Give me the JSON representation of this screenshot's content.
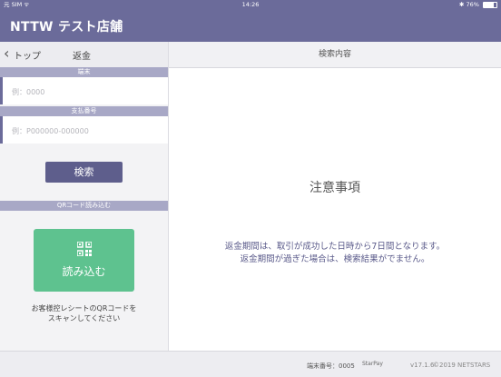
{
  "status_bar": {
    "carrier": "元 SIM ᯤ",
    "time": "14:26",
    "battery_text": "76%",
    "battery_level": 0.76
  },
  "nav": {
    "app_title": "NTTW テスト店舗"
  },
  "left_panel": {
    "back_label": "トップ",
    "panel_title": "返金",
    "terminal_section": "端末",
    "terminal_placeholder": "例：0000",
    "payment_section": "支払番号",
    "payment_placeholder": "例：P000000-000000",
    "search_button": "検索",
    "qr_section": "QRコード読み込む",
    "qr_button": "読み込む",
    "qr_note_line1": "お客様控レシートのQRコードを",
    "qr_note_line2": "スキャンしてください"
  },
  "right_panel": {
    "header": "検索内容",
    "notice_title": "注意事項",
    "notice_line1": "返金期間は、取引が成功した日時から7日間となります。",
    "notice_line2": "返金期間が過ぎた場合は、検索結果がでません。"
  },
  "footer": {
    "terminal_label": "端末番号：",
    "terminal_number": "0005",
    "logo_text": "StarPay",
    "version": "v17.1.6",
    "copyright": "©2019 NETSTARS"
  },
  "colors": {
    "nav_bg": "#6b6b9a",
    "section_header": "#a8a8c6",
    "search_button": "#5e5e8c",
    "qr_button": "#5ec28f"
  },
  "icons": {
    "back": "chevron-left-icon",
    "qr": "qr-code-icon",
    "wifi": "wifi-icon",
    "bluetooth": "bluetooth-icon",
    "battery": "battery-icon"
  }
}
